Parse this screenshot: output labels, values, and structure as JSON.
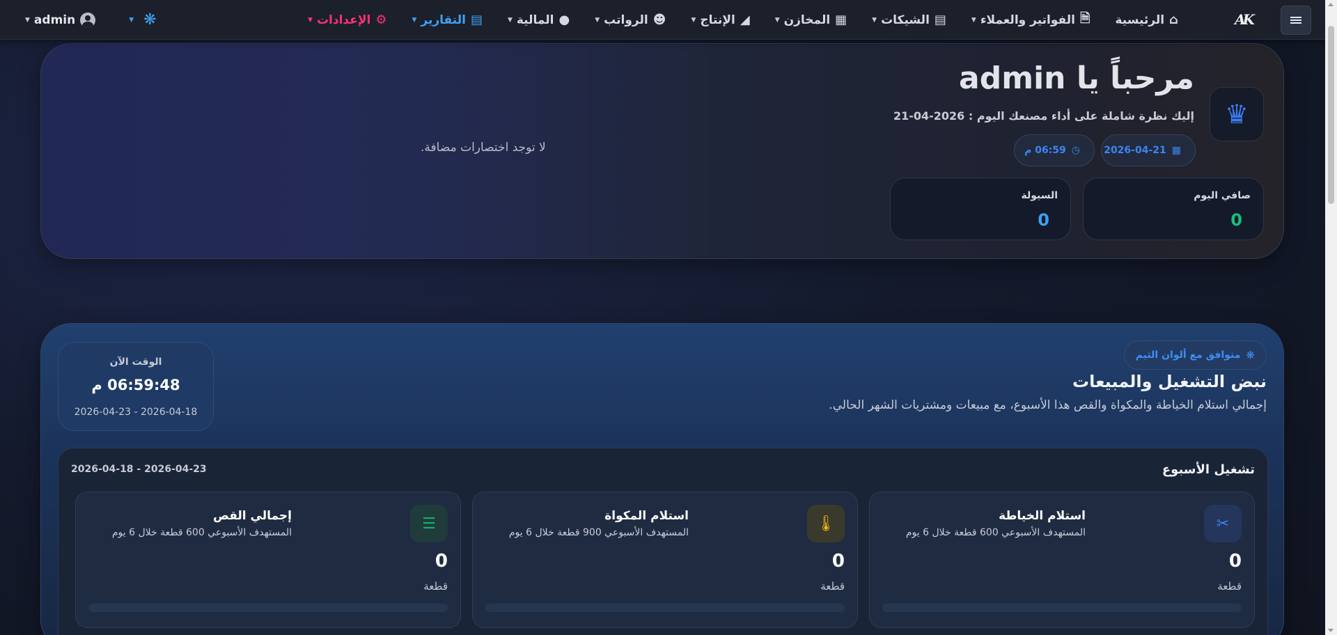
{
  "nav": {
    "items": [
      {
        "label": "الرئيسية",
        "icon": "house-icon"
      },
      {
        "label": "الفواتير والعملاء",
        "icon": "file-invoice-icon"
      },
      {
        "label": "الشيكات",
        "icon": "money-check-icon"
      },
      {
        "label": "المخازن",
        "icon": "boxes-icon"
      },
      {
        "label": "الإنتاج",
        "icon": "shirt-icon"
      },
      {
        "label": "الرواتب",
        "icon": "users-icon"
      },
      {
        "label": "المالية",
        "icon": "money-bag-icon"
      },
      {
        "label": "التقارير",
        "icon": "chart-bar-icon"
      },
      {
        "label": "الإعدادات",
        "icon": "gear-icon"
      }
    ],
    "user": "admin",
    "logo_text": "AK"
  },
  "welcome": {
    "title": "مرحباً يا admin",
    "subtitle": "إليك نظرة شاملة على أداء مصنعك اليوم : 2026-04-21",
    "date_pill": "2026-04-21",
    "time_pill": "06:59 م",
    "net_today_label": "صافي اليوم",
    "net_today_value": "0",
    "liquidity_label": "السيولة",
    "liquidity_value": "0",
    "no_shortcuts": "لا توجد اختصارات مضافة."
  },
  "ops": {
    "theme_badge": "متوافق مع ألوان الثيم",
    "title": "نبض التشغيل والمبيعات",
    "subtitle": "إجمالي استلام الخياطة والمكواة والقص هذا الأسبوع، مع مبيعات ومشتريات الشهر الحالي.",
    "clock_label": "الوقت الآن",
    "clock_time": "06:59:48 م",
    "clock_range": "2026-04-18 - 2026-04-23",
    "week_title": "تشغيل الأسبوع",
    "week_range": "2026-04-18 - 2026-04-23",
    "metrics": [
      {
        "title": "استلام الخياطة",
        "sub": "المستهدف الأسبوعي 600 قطعة خلال 6 يوم",
        "value": "0",
        "unit": "قطعة",
        "progress": 0,
        "icon": "scissors-icon",
        "color": "#3b82f6"
      },
      {
        "title": "استلام المكواة",
        "sub": "المستهدف الأسبوعي 900 قطعة خلال 6 يوم",
        "value": "0",
        "unit": "قطعة",
        "progress": 0,
        "icon": "thermometer-icon",
        "color": "#f5b71b"
      },
      {
        "title": "إجمالي القص",
        "sub": "المستهدف الأسبوعي 600 قطعة خلال 6 يوم",
        "value": "0",
        "unit": "قطعة",
        "progress": 0,
        "icon": "layers-icon",
        "color": "#14b06f"
      }
    ]
  },
  "colors": {
    "accent_blue": "#3fa2f4",
    "settings_pink": "#ff2f78",
    "net_green": "#11c27b"
  }
}
